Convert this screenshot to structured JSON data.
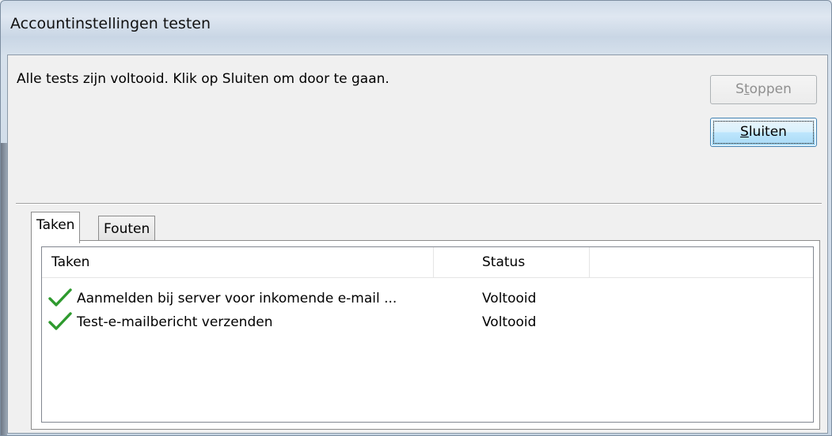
{
  "window": {
    "title": "Accountinstellingen testen"
  },
  "message": "Alle tests zijn voltooid. Klik op Sluiten om door te gaan.",
  "buttons": {
    "stop": {
      "pre": "S",
      "mnemonic": "t",
      "post": "oppen",
      "enabled": false
    },
    "close": {
      "pre": "",
      "mnemonic": "S",
      "post": "luiten",
      "default": true
    }
  },
  "tabs": [
    {
      "label": "Taken",
      "active": true
    },
    {
      "label": "Fouten",
      "active": false
    }
  ],
  "table": {
    "columns": [
      "Taken",
      "Status",
      ""
    ],
    "rows": [
      {
        "icon": "green-checkmark-icon",
        "task": "Aanmelden bij server voor inkomende e-mail ...",
        "status": "Voltooid"
      },
      {
        "icon": "green-checkmark-icon",
        "task": "Test-e-mailbericht verzenden",
        "status": "Voltooid"
      }
    ]
  },
  "colors": {
    "check": "#2e9a2e",
    "default_button_border": "#3c7fb1"
  }
}
